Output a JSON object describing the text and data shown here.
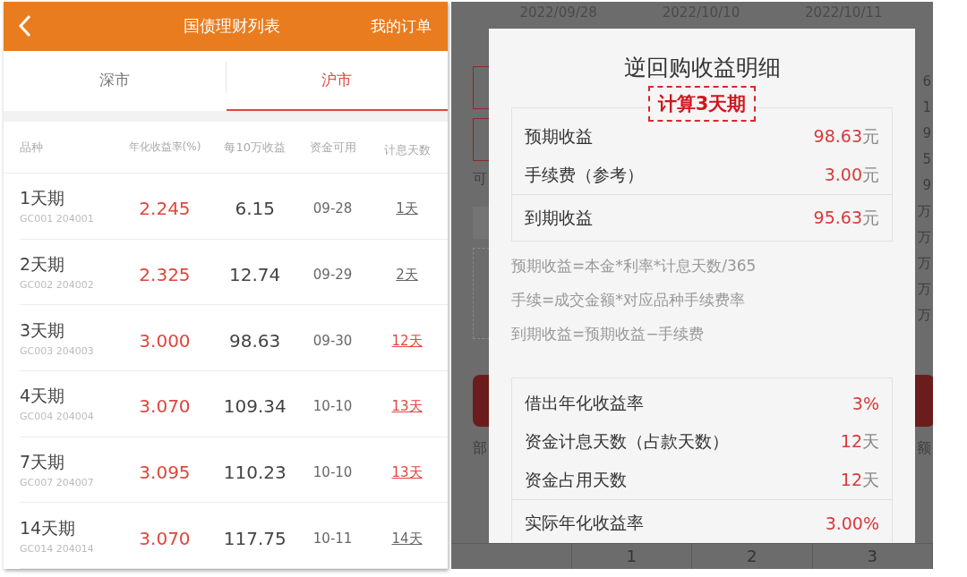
{
  "list_screen": {
    "header": {
      "title": "国债理财列表",
      "action": "我的订单"
    },
    "tabs": [
      {
        "label": "深市",
        "selected": false
      },
      {
        "label": "沪市",
        "selected": true
      }
    ],
    "table": {
      "columns": [
        "品种",
        "年化收益率(%)",
        "每10万收益",
        "资金可用",
        "计息天数"
      ],
      "rows": [
        {
          "name": "1天期",
          "code": "GC001 204001",
          "rate": "2.245",
          "income": "6.15",
          "available": "09-28",
          "days": "1天",
          "highlighted": false
        },
        {
          "name": "2天期",
          "code": "GC002 204002",
          "rate": "2.325",
          "income": "12.74",
          "available": "09-29",
          "days": "2天",
          "highlighted": false
        },
        {
          "name": "3天期",
          "code": "GC003 204003",
          "rate": "3.000",
          "income": "98.63",
          "available": "09-30",
          "days": "12天",
          "highlighted": true
        },
        {
          "name": "4天期",
          "code": "GC004 204004",
          "rate": "3.070",
          "income": "109.34",
          "available": "10-10",
          "days": "13天",
          "highlighted": true
        },
        {
          "name": "7天期",
          "code": "GC007 204007",
          "rate": "3.095",
          "income": "110.23",
          "available": "10-10",
          "days": "13天",
          "highlighted": true
        },
        {
          "name": "14天期",
          "code": "GC014 204014",
          "rate": "3.070",
          "income": "117.75",
          "available": "10-11",
          "days": "14天",
          "highlighted": false
        }
      ]
    }
  },
  "detail_screen": {
    "background": {
      "dates": [
        "2022/09/28",
        "2022/10/10",
        "2022/10/11"
      ],
      "left_fragments": [
        "可",
        "部"
      ],
      "right_values": [
        "6",
        "1",
        "9",
        "5",
        "9",
        "万",
        "万",
        "万",
        "万",
        "万"
      ],
      "right_label": "额",
      "keypad": [
        "1",
        "2",
        "3"
      ]
    },
    "dialog": {
      "title": "逆回购收益明细",
      "badge": "计算3天期",
      "summary": [
        {
          "label": "预期收益",
          "value": "98.63",
          "unit": "元",
          "total": false
        },
        {
          "label": "手续费（参考）",
          "value": "3.00",
          "unit": "元",
          "total": false
        },
        {
          "label": "到期收益",
          "value": "95.63",
          "unit": "元",
          "total": true
        }
      ],
      "formulas": [
        "预期收益=本金*利率*计息天数/365",
        "手续=成交金额*对应品种手续费率",
        "到期收益=预期收益−手续费"
      ],
      "rates": [
        {
          "label": "借出年化收益率",
          "value": "3%",
          "total": false
        },
        {
          "label": "资金计息天数（占款天数）",
          "value": "12",
          "unit": "天",
          "total": false
        },
        {
          "label": "资金占用天数",
          "value": "12",
          "unit": "天",
          "total": false
        },
        {
          "label": "实际年化收益率",
          "value": "3.00%",
          "total": true
        }
      ]
    }
  }
}
